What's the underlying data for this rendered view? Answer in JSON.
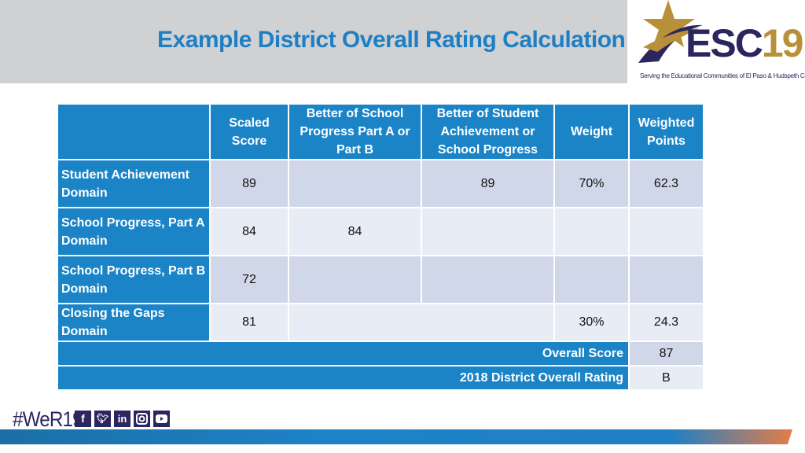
{
  "header": {
    "title": "Example District Overall Rating Calculation"
  },
  "logo": {
    "main_text": "ESC",
    "number": "19",
    "tagline": "Serving the Educational Communities of El Paso & Hudspeth Counties"
  },
  "table": {
    "columns": [
      "",
      "Scaled Score",
      "Better of School Progress Part A or Part B",
      "Better of Student Achievement or School Progress",
      "Weight",
      "Weighted Points"
    ],
    "rows": [
      {
        "label": "Student Achievement Domain",
        "scaled_score": "89",
        "better_progress": "",
        "better_achievement": "89",
        "weight": "70%",
        "weighted_points": "62.3"
      },
      {
        "label": "School Progress, Part A Domain",
        "scaled_score": "84",
        "better_progress": "84",
        "better_achievement": "",
        "weight": "",
        "weighted_points": ""
      },
      {
        "label": "School Progress, Part B Domain",
        "scaled_score": "72",
        "better_progress": "",
        "better_achievement": "",
        "weight": "",
        "weighted_points": ""
      },
      {
        "label": "Closing the Gaps Domain",
        "scaled_score": "81",
        "merged": "",
        "weight": "30%",
        "weighted_points": "24.3"
      }
    ],
    "overall_score_label": "Overall Score",
    "overall_score": "87",
    "rating_label": "2018 District Overall Rating",
    "rating": "B"
  },
  "footer": {
    "hashtag": "#WeR19",
    "social_icons": [
      "facebook-icon",
      "twitter-icon",
      "linkedin-icon",
      "instagram-icon",
      "youtube-icon"
    ]
  },
  "colors": {
    "header_blue": "#1b84c7",
    "title_blue": "#1f7fc4",
    "cell_dark": "#cfd7e8",
    "cell_light": "#e8ecf5",
    "logo_navy": "#2c2660",
    "logo_gold": "#b8903a"
  }
}
